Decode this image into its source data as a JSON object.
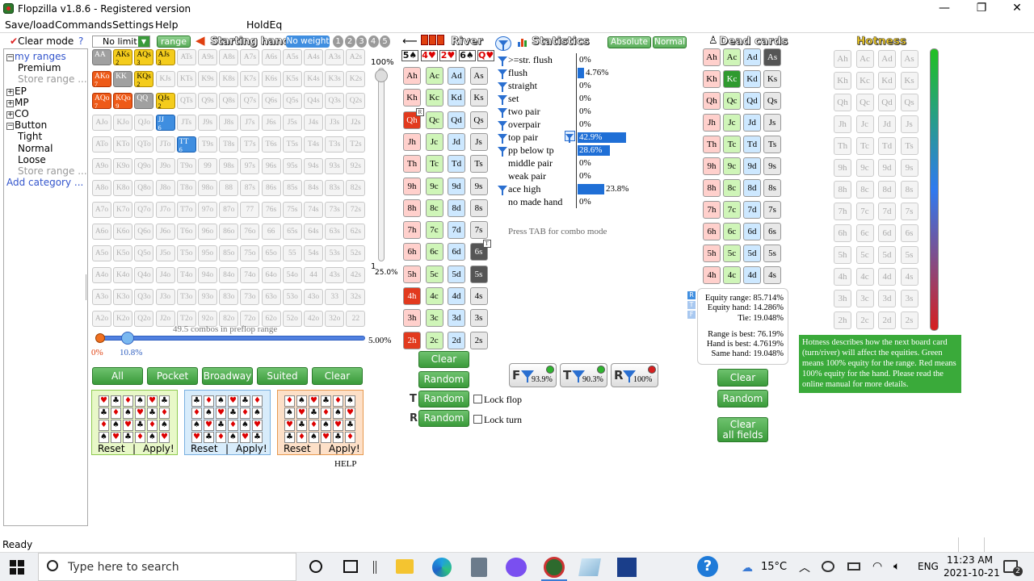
{
  "window": {
    "title": "Flopzilla v1.8.6 - Registered version"
  },
  "menu": [
    "Save/load",
    "Commands",
    "Settings",
    "Help",
    "HoldEq"
  ],
  "left": {
    "clear_mode": "Clear mode",
    "help_q": "?",
    "my_ranges": "my ranges",
    "premium": "Premium",
    "store_range": "Store range ...",
    "ep": "EP",
    "mp": "MP",
    "co": "CO",
    "button": "Button",
    "tight": "Tight",
    "normal": "Normal",
    "loose": "Loose",
    "add_category": "Add category ..."
  },
  "range_toolbar": {
    "limit": "No limit",
    "range_btn": "range",
    "starting_hand": "Starting hand",
    "no_weight": "No weight",
    "weights": [
      "1",
      "2",
      "3",
      "4",
      "5"
    ]
  },
  "grid": {
    "combos": "49.5 combos in preflop range",
    "pct_100": "100%",
    "pct_25": "25.0%",
    "pct_one": "1",
    "slider_left": "0%",
    "slider_val": "10.8%",
    "slider_right": "5.00%"
  },
  "grid_buttons": [
    "All",
    "Pocket",
    "Broadway",
    "Suited",
    "Clear"
  ],
  "presets": {
    "reset": "Reset",
    "apply": "Apply!",
    "sep": "|"
  },
  "help_link": "HELP",
  "river": {
    "title": "River",
    "board_cards": [
      "5♠",
      "4♥",
      "2♥",
      "6♠",
      "Q♥"
    ],
    "clear": "Clear",
    "random": "Random",
    "t_random": "Random",
    "r_random": "Random",
    "lock_flop": "Lock flop",
    "lock_turn": "Lock turn",
    "t_label": "T",
    "r_label": "R"
  },
  "stats": {
    "title": "Statistics",
    "absolute": "Absolute",
    "normal": "Normal",
    "tab_hint": "Press TAB for combo mode",
    "rows": [
      {
        "label": ">=str. flush",
        "value": "0%",
        "frac": 0,
        "funnel": true
      },
      {
        "label": "flush",
        "value": "4.76%",
        "frac": 0.06,
        "funnel": true
      },
      {
        "label": "straight",
        "value": "0%",
        "frac": 0,
        "funnel": true
      },
      {
        "label": "set",
        "value": "0%",
        "frac": 0,
        "funnel": true
      },
      {
        "label": "two pair",
        "value": "0%",
        "frac": 0,
        "funnel": true
      },
      {
        "label": "overpair",
        "value": "0%",
        "frac": 0,
        "funnel": true
      },
      {
        "label": "top pair",
        "value": "42.9%",
        "frac": 0.429,
        "funnel": true
      },
      {
        "label": "pp below tp",
        "value": "28.6%",
        "frac": 0.286,
        "funnel": true
      },
      {
        "label": "middle pair",
        "value": "0%",
        "frac": 0,
        "funnel": false
      },
      {
        "label": "weak pair",
        "value": "0%",
        "frac": 0,
        "funnel": false
      },
      {
        "label": "ace high",
        "value": "23.8%",
        "frac": 0.238,
        "funnel": true
      },
      {
        "label": "no made hand",
        "value": "0%",
        "frac": 0,
        "funnel": false
      }
    ],
    "filters": [
      {
        "letter": "F",
        "pct": "93.9%",
        "dot": "#2fb52f"
      },
      {
        "letter": "T",
        "pct": "90.3%",
        "dot": "#2fb52f"
      },
      {
        "letter": "R",
        "pct": "100%",
        "dot": "#d61f1f"
      }
    ]
  },
  "dead": {
    "title": "Dead cards",
    "clear": "Clear",
    "random": "Random",
    "clear_all": "Clear\nall fields"
  },
  "equity": {
    "eq_range": "Equity range: 85.714%",
    "eq_hand": "Equity hand: 14.286%",
    "tie": "Tie: 19.048%",
    "range_best": "Range is best: 76.19%",
    "hand_best": "Hand is best: 4.7619%",
    "same": "Same hand: 19.048%"
  },
  "hotness": {
    "title": "Hotness",
    "info": "Hotness describes how the next board card (turn/river) will affect the equities. Green means 100% equity for the range. Red means 100% equity for the hand. Please read the online manual for more details."
  },
  "status": "Ready",
  "taskbar": {
    "search": "Type here to search",
    "temp": "15°C",
    "lang": "ENG",
    "time": "11:23 AM",
    "date": "2021-10-21",
    "notif": "2"
  },
  "colors": {
    "accent_green": "#3a9a3a",
    "hand_yellow": "#f4cc1c",
    "hand_orange": "#ee5a18",
    "hand_blue": "#3f8ee0",
    "bar_blue": "#1f6fd6"
  }
}
